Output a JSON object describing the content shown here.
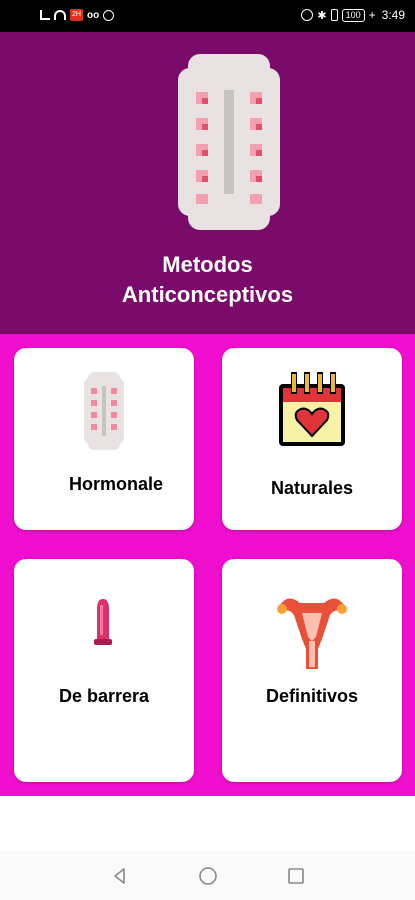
{
  "status_bar": {
    "notification_badge": "2H",
    "voicemail": "oo",
    "bluetooth": "✱",
    "battery": "100",
    "charging": "+",
    "time": "3:49"
  },
  "header": {
    "title_line1": "Metodos",
    "title_line2": "Anticonceptivos",
    "background_color": "#7b0b6b",
    "hero_icon": "contraceptive-pill-pack-icon"
  },
  "grid": {
    "background_color": "#f10fcf",
    "cards": [
      {
        "label": "Hormonale",
        "icon": "pill-pack-icon"
      },
      {
        "label": "Naturales",
        "icon": "calendar-heart-icon"
      },
      {
        "label": "De barrera",
        "icon": "condom-icon"
      },
      {
        "label": "Definitivos",
        "icon": "uterus-icon"
      }
    ]
  },
  "nav_bar": {
    "back_icon": "back-triangle-icon",
    "home_icon": "home-circle-icon",
    "recent_icon": "recent-square-icon"
  }
}
